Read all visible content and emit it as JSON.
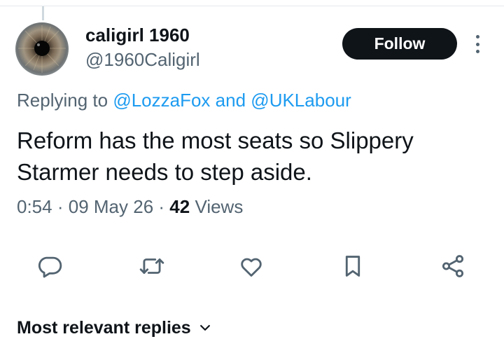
{
  "tweet": {
    "author": {
      "display_name": "caligirl 1960",
      "handle": "@1960Caligirl"
    },
    "follow_label": "Follow",
    "replying_prefix": "Replying to",
    "replying_mention_1": "@LozzaFox",
    "replying_and": "and",
    "replying_mention_2": "@UKLabour",
    "text": "Reform has the most seats so Slippery Starmer needs to step aside.",
    "time": "0:54",
    "date": "09 May 26",
    "separator": "·",
    "views_count": "42",
    "views_label": "Views"
  },
  "actions": {
    "icons": [
      "reply-icon",
      "retweet-icon",
      "like-icon",
      "bookmark-icon",
      "share-icon"
    ]
  },
  "replies_sort": {
    "label": "Most relevant replies"
  },
  "colors": {
    "accent": "#1d9bf0",
    "secondary_text": "#536471",
    "primary_text": "#0f1419",
    "icon": "#536471",
    "divider": "#e6e9ec"
  }
}
